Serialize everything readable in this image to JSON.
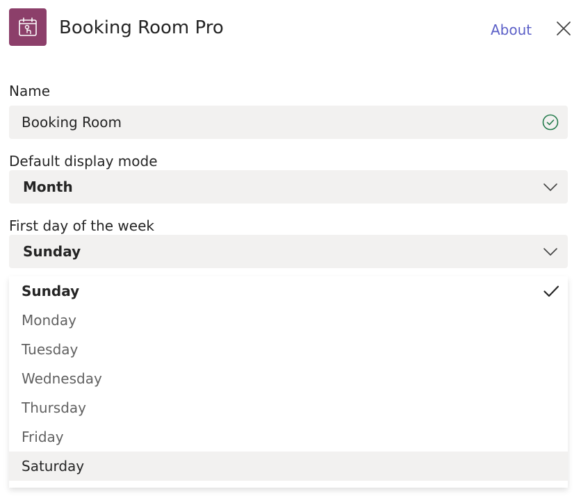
{
  "header": {
    "app_name": "Booking Room Pro",
    "app_icon": "booking-app-icon",
    "about_label": "About",
    "close_icon": "close-icon"
  },
  "colors": {
    "app_icon_bg": "#8c3f6a",
    "link": "#5b5fc7",
    "field_bg": "#f2f1f0",
    "valid_check": "#237b4b"
  },
  "form": {
    "name": {
      "label": "Name",
      "value": "Booking Room",
      "status_icon": "valid-check-circle-icon"
    },
    "display_mode": {
      "label": "Default display mode",
      "value": "Month"
    },
    "first_day": {
      "label": "First day of the week",
      "value": "Sunday",
      "options": [
        "Sunday",
        "Monday",
        "Tuesday",
        "Wednesday",
        "Thursday",
        "Friday",
        "Saturday"
      ],
      "selected": "Sunday",
      "hovered": "Saturday"
    }
  }
}
